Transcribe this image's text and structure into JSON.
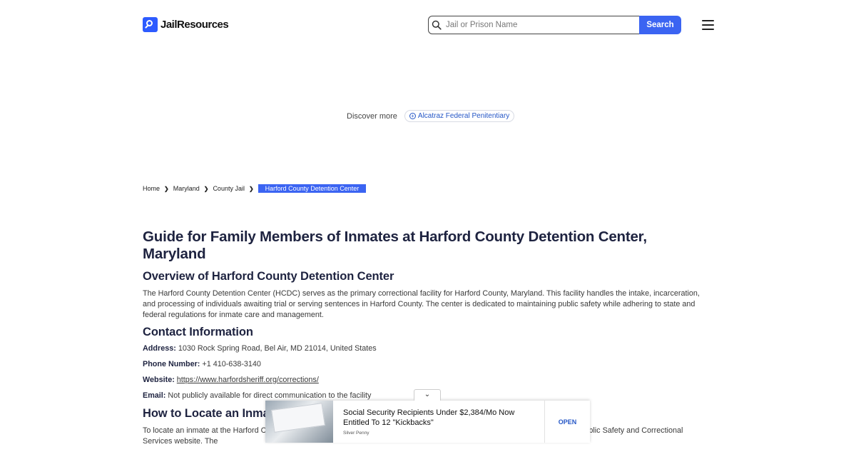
{
  "header": {
    "logo_text": "JailResources",
    "search_placeholder": "Jail or Prison Name",
    "search_button": "Search"
  },
  "discover": {
    "label": "Discover more",
    "chip": "Alcatraz Federal Penitentiary"
  },
  "breadcrumb": {
    "items": [
      "Home",
      "Maryland",
      "County Jail"
    ],
    "current": "Harford County Detention Center"
  },
  "article": {
    "title": "Guide for Family Members of Inmates at Harford County Detention Center, Maryland",
    "overview_heading": "Overview of Harford County Detention Center",
    "overview_text": "The Harford County Detention Center (HCDC) serves as the primary correctional facility for Harford County, Maryland. This facility handles the intake, incarceration, and processing of individuals awaiting trial or serving sentences in Harford County. The center is dedicated to maintaining public safety while adhering to state and federal regulations for inmate care and management.",
    "contact_heading": "Contact Information",
    "address_label": "Address:",
    "address_value": "1030 Rock Spring Road, Bel Air, MD 21014, United States",
    "phone_label": "Phone Number:",
    "phone_value": "+1 410-638-3140",
    "website_label": "Website:",
    "website_value": "https://www.harfordsheriff.org/corrections/",
    "email_label": "Email:",
    "email_value": "Not publicly available for direct communication to the facility",
    "locate_heading": "How to Locate an Inmate",
    "locate_text": "To locate an inmate at the Harford County Detention Center, you can use the inmate search tool on the Maryland Department of Public Safety and Correctional Services website. The"
  },
  "ad": {
    "title": "Social Security Recipients Under $2,384/Mo Now Entitled To 12 \"Kickbacks\"",
    "source": "Silver Penny",
    "cta": "OPEN"
  }
}
